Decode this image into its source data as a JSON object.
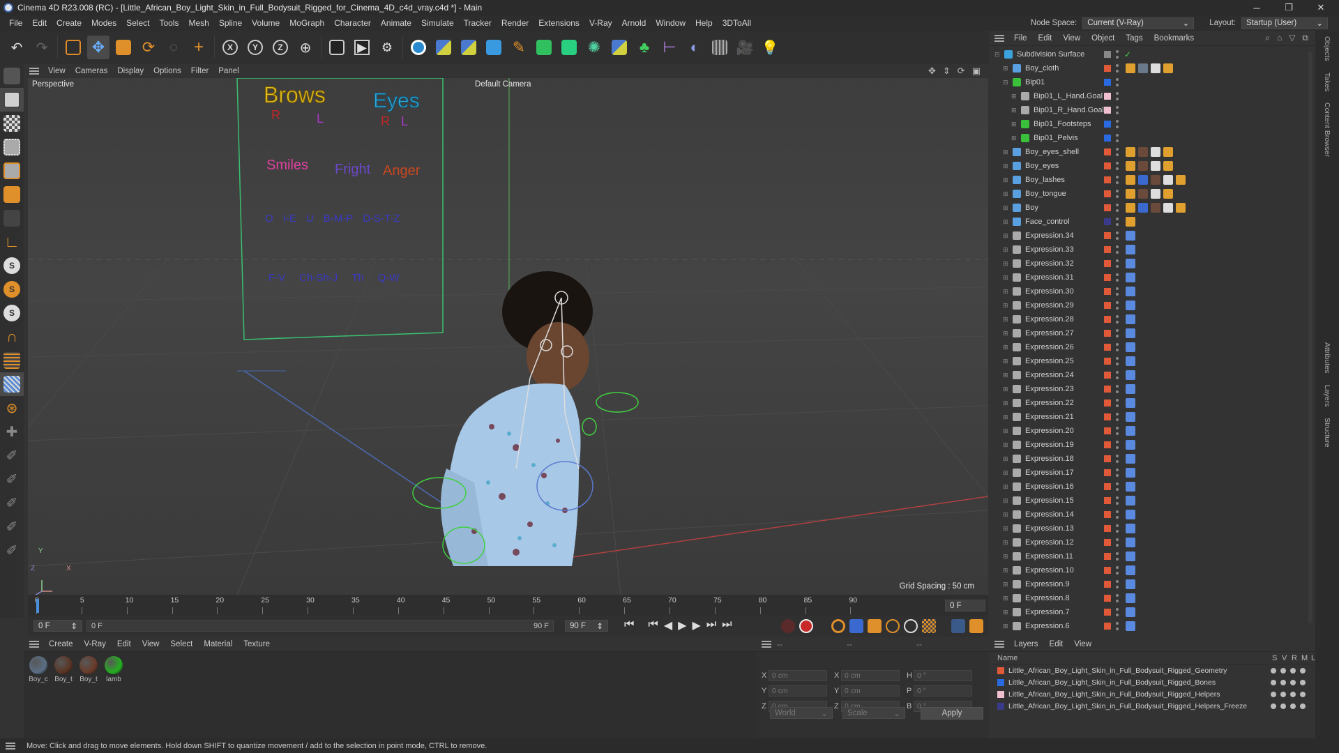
{
  "window": {
    "title": "Cinema 4D R23.008 (RC) - [Little_African_Boy_Light_Skin_in_Full_Bodysuit_Rigged_for_Cinema_4D_c4d_vray.c4d *] - Main",
    "controls": {
      "minimize": "─",
      "maximize": "❐",
      "close": "✕"
    }
  },
  "menubar": {
    "items": [
      "File",
      "Edit",
      "Create",
      "Modes",
      "Select",
      "Tools",
      "Mesh",
      "Spline",
      "Volume",
      "MoGraph",
      "Character",
      "Animate",
      "Simulate",
      "Tracker",
      "Render",
      "Extensions",
      "V-Ray",
      "Arnold",
      "Window",
      "Help",
      "3DToAll"
    ],
    "node_space_label": "Node Space:",
    "node_space_value": "Current (V-Ray)",
    "layout_label": "Layout:",
    "layout_value": "Startup (User)"
  },
  "toolbar": {
    "axis_x": "X",
    "axis_y": "Y",
    "axis_z": "Z"
  },
  "viewport": {
    "menu": [
      "View",
      "Cameras",
      "Display",
      "Options",
      "Filter",
      "Panel"
    ],
    "label": "Perspective",
    "camera": "Default Camera",
    "grid_spacing": "Grid Spacing : 50 cm",
    "axis_y": "Y",
    "axis_z": "Z",
    "axis_x": "X",
    "face_board": {
      "brows": "Brows",
      "eyes": "Eyes",
      "r": "R",
      "l": "L",
      "smiles": "Smiles",
      "fright": "Fright",
      "anger": "Anger",
      "phonemes_row1": [
        "O",
        "I-E",
        "U",
        "B-M-P",
        "D-S-T-Z"
      ],
      "phonemes_row2": [
        "F-V",
        "Ch-Sh-J",
        "Th",
        "Q-W"
      ]
    }
  },
  "timeline": {
    "ticks": [
      "0",
      "5",
      "10",
      "15",
      "20",
      "25",
      "30",
      "35",
      "40",
      "45",
      "50",
      "55",
      "60",
      "65",
      "70",
      "75",
      "80",
      "85",
      "90"
    ],
    "current_frame": "0 F"
  },
  "transport": {
    "start_field": "0 F",
    "range_start": "0 F",
    "range_end": "90 F",
    "end_field": "90 F"
  },
  "materials": {
    "menu": [
      "Create",
      "V-Ray",
      "Edit",
      "View",
      "Select",
      "Material",
      "Texture"
    ],
    "items": [
      {
        "label": "Boy_c",
        "color": "#5a6e86"
      },
      {
        "label": "Boy_t",
        "color": "#5a3424"
      },
      {
        "label": "Boy_t",
        "color": "#6a3a28"
      },
      {
        "label": "lamb",
        "color": "#23b01e"
      }
    ]
  },
  "coordinates": {
    "header": [
      "--",
      "--",
      "--"
    ],
    "rows": [
      {
        "l1": "X",
        "v1": "0 cm",
        "l2": "X",
        "v2": "0 cm",
        "l3": "H",
        "v3": "0 °"
      },
      {
        "l1": "Y",
        "v1": "0 cm",
        "l2": "Y",
        "v2": "0 cm",
        "l3": "P",
        "v3": "0 °"
      },
      {
        "l1": "Z",
        "v1": "0 cm",
        "l2": "Z",
        "v2": "0 cm",
        "l3": "B",
        "v3": "0 °"
      }
    ],
    "space": "World",
    "mode": "Scale",
    "apply": "Apply"
  },
  "objects": {
    "menu": [
      "File",
      "Edit",
      "View",
      "Object",
      "Tags",
      "Bookmarks"
    ],
    "items": [
      {
        "name": "Subdivision Surface",
        "color": "#888888",
        "icon_color": "#3aa3e0",
        "tags": []
      },
      {
        "name": "Boy_cloth",
        "color": "#e05a3a",
        "icon_color": "#5aa0e0",
        "tags": [
          "#e0a030",
          "#6a7a8a",
          "#dddddd",
          "#e0a030"
        ]
      },
      {
        "name": "Bip01",
        "color": "#2a6ae0",
        "icon_color": "#3ac03a",
        "tags": []
      },
      {
        "name": "Bip01_L_Hand.Goal",
        "color": "#f0c0d0",
        "icon_color": "#aaaaaa",
        "tags": []
      },
      {
        "name": "Bip01_R_Hand.Goal",
        "color": "#f0c0d0",
        "icon_color": "#aaaaaa",
        "tags": []
      },
      {
        "name": "Bip01_Footsteps",
        "color": "#2a6ae0",
        "icon_color": "#3ac03a",
        "tags": []
      },
      {
        "name": "Bip01_Pelvis",
        "color": "#2a6ae0",
        "icon_color": "#3ac03a",
        "tags": []
      },
      {
        "name": "Boy_eyes_shell",
        "color": "#e05a3a",
        "icon_color": "#5aa0e0",
        "tags": [
          "#e0a030",
          "#6a4a3a",
          "#dddddd",
          "#e0a030"
        ]
      },
      {
        "name": "Boy_eyes",
        "color": "#e05a3a",
        "icon_color": "#5aa0e0",
        "tags": [
          "#e0a030",
          "#6a4a3a",
          "#dddddd",
          "#e0a030"
        ]
      },
      {
        "name": "Boy_lashes",
        "color": "#e05a3a",
        "icon_color": "#5aa0e0",
        "tags": [
          "#e0a030",
          "#3a6ad0",
          "#6a4a3a",
          "#dddddd",
          "#e0a030"
        ]
      },
      {
        "name": "Boy_tongue",
        "color": "#e05a3a",
        "icon_color": "#5aa0e0",
        "tags": [
          "#e0a030",
          "#6a4a3a",
          "#dddddd",
          "#e0a030"
        ]
      },
      {
        "name": "Boy",
        "color": "#e05a3a",
        "icon_color": "#5aa0e0",
        "tags": [
          "#e0a030",
          "#3a6ad0",
          "#6a4a3a",
          "#dddddd",
          "#e0a030"
        ]
      },
      {
        "name": "Face_control",
        "color": "#3a3a8a",
        "icon_color": "#5aa0e0",
        "tags": [
          "#e0a030"
        ]
      },
      {
        "name": "Expression.34",
        "color": "#e05a3a",
        "icon_color": "#aaaaaa",
        "tags": [
          "#5a8ae0"
        ]
      },
      {
        "name": "Expression.33",
        "color": "#e05a3a",
        "icon_color": "#aaaaaa",
        "tags": [
          "#5a8ae0"
        ]
      },
      {
        "name": "Expression.32",
        "color": "#e05a3a",
        "icon_color": "#aaaaaa",
        "tags": [
          "#5a8ae0"
        ]
      },
      {
        "name": "Expression.31",
        "color": "#e05a3a",
        "icon_color": "#aaaaaa",
        "tags": [
          "#5a8ae0"
        ]
      },
      {
        "name": "Expression.30",
        "color": "#e05a3a",
        "icon_color": "#aaaaaa",
        "tags": [
          "#5a8ae0"
        ]
      },
      {
        "name": "Expression.29",
        "color": "#e05a3a",
        "icon_color": "#aaaaaa",
        "tags": [
          "#5a8ae0"
        ]
      },
      {
        "name": "Expression.28",
        "color": "#e05a3a",
        "icon_color": "#aaaaaa",
        "tags": [
          "#5a8ae0"
        ]
      },
      {
        "name": "Expression.27",
        "color": "#e05a3a",
        "icon_color": "#aaaaaa",
        "tags": [
          "#5a8ae0"
        ]
      },
      {
        "name": "Expression.26",
        "color": "#e05a3a",
        "icon_color": "#aaaaaa",
        "tags": [
          "#5a8ae0"
        ]
      },
      {
        "name": "Expression.25",
        "color": "#e05a3a",
        "icon_color": "#aaaaaa",
        "tags": [
          "#5a8ae0"
        ]
      },
      {
        "name": "Expression.24",
        "color": "#e05a3a",
        "icon_color": "#aaaaaa",
        "tags": [
          "#5a8ae0"
        ]
      },
      {
        "name": "Expression.23",
        "color": "#e05a3a",
        "icon_color": "#aaaaaa",
        "tags": [
          "#5a8ae0"
        ]
      },
      {
        "name": "Expression.22",
        "color": "#e05a3a",
        "icon_color": "#aaaaaa",
        "tags": [
          "#5a8ae0"
        ]
      },
      {
        "name": "Expression.21",
        "color": "#e05a3a",
        "icon_color": "#aaaaaa",
        "tags": [
          "#5a8ae0"
        ]
      },
      {
        "name": "Expression.20",
        "color": "#e05a3a",
        "icon_color": "#aaaaaa",
        "tags": [
          "#5a8ae0"
        ]
      },
      {
        "name": "Expression.19",
        "color": "#e05a3a",
        "icon_color": "#aaaaaa",
        "tags": [
          "#5a8ae0"
        ]
      },
      {
        "name": "Expression.18",
        "color": "#e05a3a",
        "icon_color": "#aaaaaa",
        "tags": [
          "#5a8ae0"
        ]
      },
      {
        "name": "Expression.17",
        "color": "#e05a3a",
        "icon_color": "#aaaaaa",
        "tags": [
          "#5a8ae0"
        ]
      },
      {
        "name": "Expression.16",
        "color": "#e05a3a",
        "icon_color": "#aaaaaa",
        "tags": [
          "#5a8ae0"
        ]
      },
      {
        "name": "Expression.15",
        "color": "#e05a3a",
        "icon_color": "#aaaaaa",
        "tags": [
          "#5a8ae0"
        ]
      },
      {
        "name": "Expression.14",
        "color": "#e05a3a",
        "icon_color": "#aaaaaa",
        "tags": [
          "#5a8ae0"
        ]
      },
      {
        "name": "Expression.13",
        "color": "#e05a3a",
        "icon_color": "#aaaaaa",
        "tags": [
          "#5a8ae0"
        ]
      },
      {
        "name": "Expression.12",
        "color": "#e05a3a",
        "icon_color": "#aaaaaa",
        "tags": [
          "#5a8ae0"
        ]
      },
      {
        "name": "Expression.11",
        "color": "#e05a3a",
        "icon_color": "#aaaaaa",
        "tags": [
          "#5a8ae0"
        ]
      },
      {
        "name": "Expression.10",
        "color": "#e05a3a",
        "icon_color": "#aaaaaa",
        "tags": [
          "#5a8ae0"
        ]
      },
      {
        "name": "Expression.9",
        "color": "#e05a3a",
        "icon_color": "#aaaaaa",
        "tags": [
          "#5a8ae0"
        ]
      },
      {
        "name": "Expression.8",
        "color": "#e05a3a",
        "icon_color": "#aaaaaa",
        "tags": [
          "#5a8ae0"
        ]
      },
      {
        "name": "Expression.7",
        "color": "#e05a3a",
        "icon_color": "#aaaaaa",
        "tags": [
          "#5a8ae0"
        ]
      },
      {
        "name": "Expression.6",
        "color": "#e05a3a",
        "icon_color": "#aaaaaa",
        "tags": [
          "#5a8ae0"
        ]
      }
    ]
  },
  "layers": {
    "menu": [
      "Layers",
      "Edit",
      "View"
    ],
    "columns": [
      "Name",
      "S",
      "V",
      "R",
      "M",
      "L"
    ],
    "items": [
      {
        "name": "Little_African_Boy_Light_Skin_in_Full_Bodysuit_Rigged_Geometry",
        "color": "#e05a3a"
      },
      {
        "name": "Little_African_Boy_Light_Skin_in_Full_Bodysuit_Rigged_Bones",
        "color": "#2a6ae0"
      },
      {
        "name": "Little_African_Boy_Light_Skin_in_Full_Bodysuit_Rigged_Helpers",
        "color": "#f0c0d0"
      },
      {
        "name": "Little_African_Boy_Light_Skin_in_Full_Bodysuit_Rigged_Helpers_Freeze",
        "color": "#3a3a8a"
      }
    ]
  },
  "right_tabs": [
    "Objects",
    "Takes",
    "Content Browser",
    "Attributes",
    "Layers",
    "Structure"
  ],
  "status": "Move: Click and drag to move elements. Hold down SHIFT to quantize movement / add to the selection in point mode, CTRL to remove."
}
